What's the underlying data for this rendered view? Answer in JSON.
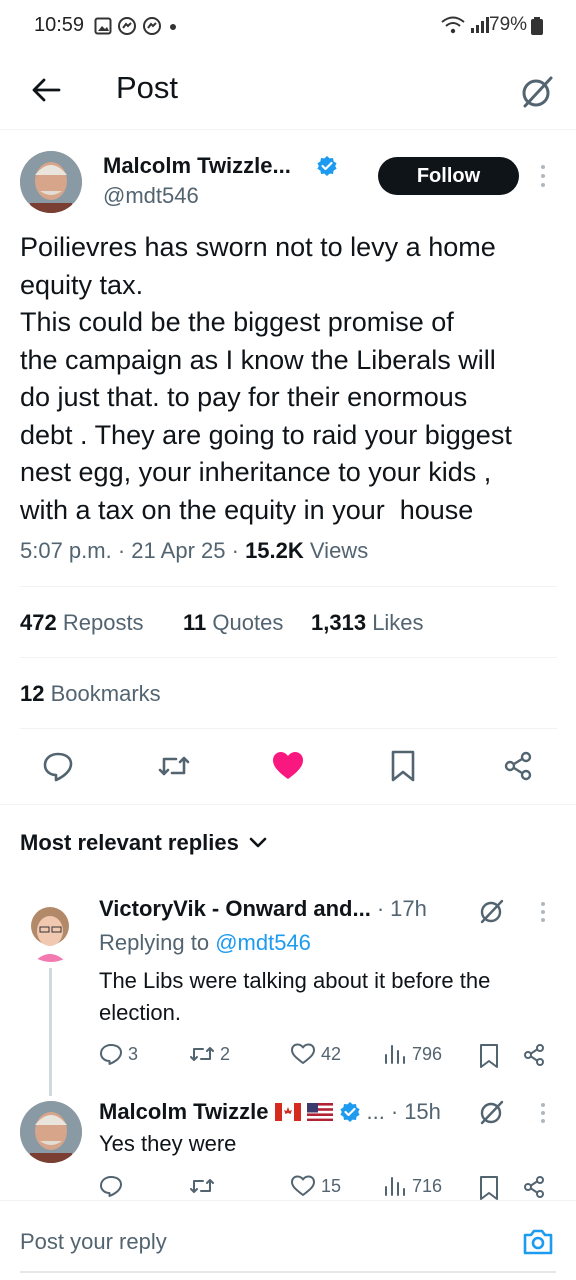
{
  "status_bar": {
    "time": "10:59",
    "battery": "79%"
  },
  "header": {
    "title": "Post"
  },
  "post": {
    "author_name": "Malcolm Twizzle...",
    "author_handle": "@mdt546",
    "follow_label": "Follow",
    "text": "Poilievres has sworn not to levy a home\nequity tax.\nThis could be the biggest promise of\nthe campaign as I know the Liberals will\ndo just that. to pay for their enormous\ndebt . They are going to raid your biggest\nnest egg, your inheritance to your kids ,\nwith a tax on the equity in your  house",
    "time": "5:07 p.m.",
    "date": "21 Apr 25",
    "views_count": "15.2K",
    "views_label": "Views",
    "reposts_count": "472",
    "reposts_label": "Reposts",
    "quotes_count": "11",
    "quotes_label": "Quotes",
    "likes_count": "1,313",
    "likes_label": "Likes",
    "bookmarks_count": "12",
    "bookmarks_label": "Bookmarks"
  },
  "sort_label": "Most relevant replies",
  "replies": [
    {
      "author_name": "VictoryVik - Onward and...",
      "time": "17h",
      "replying_prefix": "Replying to",
      "replying_to": "@mdt546",
      "text": "The Libs were talking about it before the election.",
      "reply_count": "3",
      "repost_count": "2",
      "like_count": "42",
      "view_count": "796"
    },
    {
      "author_name": "Malcolm Twizzle",
      "ellipsis": "...",
      "time": "15h",
      "text": "Yes they were",
      "reply_count": "",
      "repost_count": "",
      "like_count": "15",
      "view_count": "716"
    }
  ],
  "composer": {
    "placeholder": "Post your reply"
  },
  "colors": {
    "accent": "#1d9bf0",
    "like": "#f91880",
    "text": "#0f1419",
    "muted": "#536471"
  }
}
